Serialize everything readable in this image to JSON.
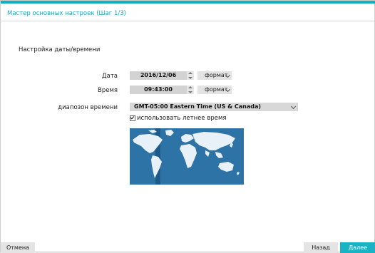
{
  "wizard": {
    "title": "Мастер основных настроек (Шаг 1/3)"
  },
  "section": {
    "title": "Настройка даты/времени"
  },
  "date": {
    "label": "Дата",
    "value": "2016/12/06",
    "format_label": "формат"
  },
  "time": {
    "label": "Время",
    "value": "09:43:00",
    "format_label": "формат"
  },
  "timezone": {
    "label": "диапозон времени",
    "value": "GMT-05:00   Eastern Time (US & Canada)"
  },
  "dst": {
    "label": "использовать летнее время",
    "checked": true
  },
  "map": {
    "ocean_color": "#2e73a6",
    "land_color": "#e8f1f8",
    "highlight_color": "#1e5a88"
  },
  "footer": {
    "cancel_label": "Отмена",
    "back_label": "Назад",
    "next_label": "Далее"
  },
  "colors": {
    "accent": "#17a8bb",
    "next_button": "#18b4c4"
  }
}
